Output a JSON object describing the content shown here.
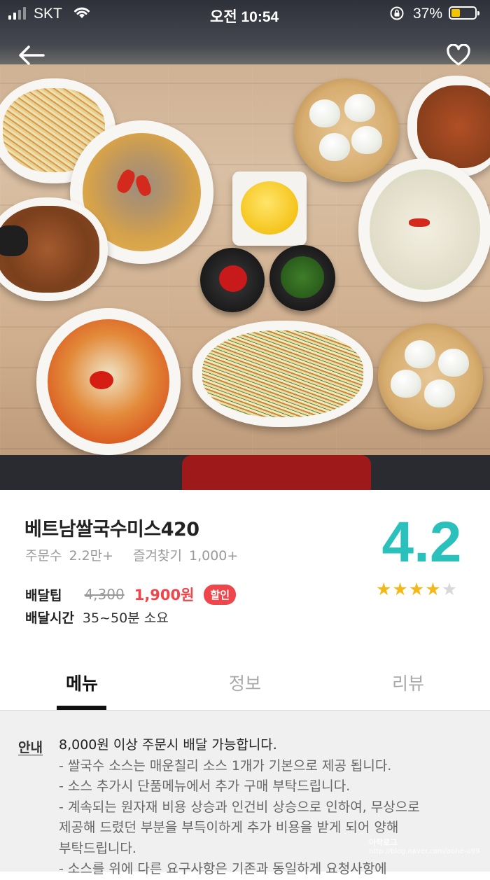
{
  "status_bar": {
    "carrier": "SKT",
    "time": "오전 10:54",
    "battery_percent": "37%",
    "battery_level": 0.37,
    "icons": [
      "signal-icon",
      "wifi-icon",
      "orientation-lock-icon",
      "battery-icon"
    ]
  },
  "nav": {
    "back_icon": "arrow-left-icon",
    "favorite_icon": "heart-outline-icon"
  },
  "store": {
    "name": "베트남쌀국수미스420",
    "orders_label": "주문수",
    "orders_value": "2.2만+",
    "favorites_label": "즐겨찾기",
    "favorites_value": "1,000+",
    "rating": "4.2",
    "stars_filled": 4,
    "stars_total": 5,
    "delivery_tip_label": "배달팁",
    "delivery_tip_original": "4,300",
    "delivery_tip_discounted": "1,900원",
    "discount_badge": "할인",
    "delivery_time_label": "배달시간",
    "delivery_time_value": "35~50분 소요"
  },
  "tabs": [
    {
      "label": "메뉴",
      "active": true
    },
    {
      "label": "정보",
      "active": false
    },
    {
      "label": "리뷰",
      "active": false
    }
  ],
  "notice": {
    "tag": "안내",
    "heading": "8,000원 이상 주문시 배달 가능합니다.",
    "lines": [
      "- 쌀국수 소스는  매운칠리 소스  1개가 기본으로 제공 됩니다.",
      "- 소스 추가시 단품메뉴에서 추가 구매 부탁드립니다.",
      "- 계속되는 원자재 비용 상승과 인건비 상승으로 인하여, 무상으로",
      "제공해 드렸던 부분을 부득이하게 추가 비용을 받게 되어 양해",
      "부탁드립니다.",
      "- 소스를 위에 다른 요구사항은 기존과 동일하게 요청사항에"
    ]
  },
  "watermark": {
    "title": "아락로그",
    "url": "http://blog.naver.com/aohe-o99"
  },
  "colors": {
    "accent": "#2ac1bc",
    "discount": "#f0464b",
    "star": "#f5b81c",
    "battery": "#f5c400"
  }
}
